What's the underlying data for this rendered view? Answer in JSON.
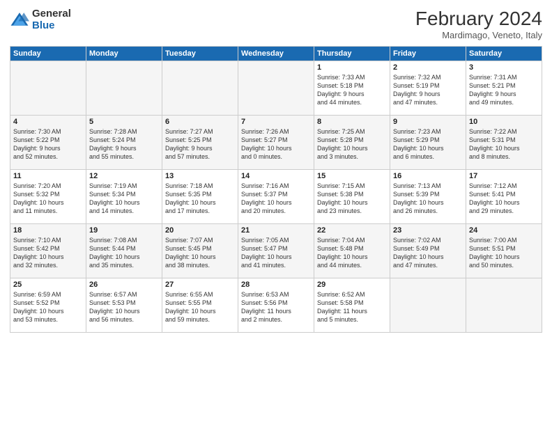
{
  "logo": {
    "line1": "General",
    "line2": "Blue"
  },
  "title": "February 2024",
  "subtitle": "Mardimago, Veneto, Italy",
  "days_of_week": [
    "Sunday",
    "Monday",
    "Tuesday",
    "Wednesday",
    "Thursday",
    "Friday",
    "Saturday"
  ],
  "weeks": [
    [
      {
        "day": "",
        "info": ""
      },
      {
        "day": "",
        "info": ""
      },
      {
        "day": "",
        "info": ""
      },
      {
        "day": "",
        "info": ""
      },
      {
        "day": "1",
        "info": "Sunrise: 7:33 AM\nSunset: 5:18 PM\nDaylight: 9 hours\nand 44 minutes."
      },
      {
        "day": "2",
        "info": "Sunrise: 7:32 AM\nSunset: 5:19 PM\nDaylight: 9 hours\nand 47 minutes."
      },
      {
        "day": "3",
        "info": "Sunrise: 7:31 AM\nSunset: 5:21 PM\nDaylight: 9 hours\nand 49 minutes."
      }
    ],
    [
      {
        "day": "4",
        "info": "Sunrise: 7:30 AM\nSunset: 5:22 PM\nDaylight: 9 hours\nand 52 minutes."
      },
      {
        "day": "5",
        "info": "Sunrise: 7:28 AM\nSunset: 5:24 PM\nDaylight: 9 hours\nand 55 minutes."
      },
      {
        "day": "6",
        "info": "Sunrise: 7:27 AM\nSunset: 5:25 PM\nDaylight: 9 hours\nand 57 minutes."
      },
      {
        "day": "7",
        "info": "Sunrise: 7:26 AM\nSunset: 5:27 PM\nDaylight: 10 hours\nand 0 minutes."
      },
      {
        "day": "8",
        "info": "Sunrise: 7:25 AM\nSunset: 5:28 PM\nDaylight: 10 hours\nand 3 minutes."
      },
      {
        "day": "9",
        "info": "Sunrise: 7:23 AM\nSunset: 5:29 PM\nDaylight: 10 hours\nand 6 minutes."
      },
      {
        "day": "10",
        "info": "Sunrise: 7:22 AM\nSunset: 5:31 PM\nDaylight: 10 hours\nand 8 minutes."
      }
    ],
    [
      {
        "day": "11",
        "info": "Sunrise: 7:20 AM\nSunset: 5:32 PM\nDaylight: 10 hours\nand 11 minutes."
      },
      {
        "day": "12",
        "info": "Sunrise: 7:19 AM\nSunset: 5:34 PM\nDaylight: 10 hours\nand 14 minutes."
      },
      {
        "day": "13",
        "info": "Sunrise: 7:18 AM\nSunset: 5:35 PM\nDaylight: 10 hours\nand 17 minutes."
      },
      {
        "day": "14",
        "info": "Sunrise: 7:16 AM\nSunset: 5:37 PM\nDaylight: 10 hours\nand 20 minutes."
      },
      {
        "day": "15",
        "info": "Sunrise: 7:15 AM\nSunset: 5:38 PM\nDaylight: 10 hours\nand 23 minutes."
      },
      {
        "day": "16",
        "info": "Sunrise: 7:13 AM\nSunset: 5:39 PM\nDaylight: 10 hours\nand 26 minutes."
      },
      {
        "day": "17",
        "info": "Sunrise: 7:12 AM\nSunset: 5:41 PM\nDaylight: 10 hours\nand 29 minutes."
      }
    ],
    [
      {
        "day": "18",
        "info": "Sunrise: 7:10 AM\nSunset: 5:42 PM\nDaylight: 10 hours\nand 32 minutes."
      },
      {
        "day": "19",
        "info": "Sunrise: 7:08 AM\nSunset: 5:44 PM\nDaylight: 10 hours\nand 35 minutes."
      },
      {
        "day": "20",
        "info": "Sunrise: 7:07 AM\nSunset: 5:45 PM\nDaylight: 10 hours\nand 38 minutes."
      },
      {
        "day": "21",
        "info": "Sunrise: 7:05 AM\nSunset: 5:47 PM\nDaylight: 10 hours\nand 41 minutes."
      },
      {
        "day": "22",
        "info": "Sunrise: 7:04 AM\nSunset: 5:48 PM\nDaylight: 10 hours\nand 44 minutes."
      },
      {
        "day": "23",
        "info": "Sunrise: 7:02 AM\nSunset: 5:49 PM\nDaylight: 10 hours\nand 47 minutes."
      },
      {
        "day": "24",
        "info": "Sunrise: 7:00 AM\nSunset: 5:51 PM\nDaylight: 10 hours\nand 50 minutes."
      }
    ],
    [
      {
        "day": "25",
        "info": "Sunrise: 6:59 AM\nSunset: 5:52 PM\nDaylight: 10 hours\nand 53 minutes."
      },
      {
        "day": "26",
        "info": "Sunrise: 6:57 AM\nSunset: 5:53 PM\nDaylight: 10 hours\nand 56 minutes."
      },
      {
        "day": "27",
        "info": "Sunrise: 6:55 AM\nSunset: 5:55 PM\nDaylight: 10 hours\nand 59 minutes."
      },
      {
        "day": "28",
        "info": "Sunrise: 6:53 AM\nSunset: 5:56 PM\nDaylight: 11 hours\nand 2 minutes."
      },
      {
        "day": "29",
        "info": "Sunrise: 6:52 AM\nSunset: 5:58 PM\nDaylight: 11 hours\nand 5 minutes."
      },
      {
        "day": "",
        "info": ""
      },
      {
        "day": "",
        "info": ""
      }
    ]
  ]
}
